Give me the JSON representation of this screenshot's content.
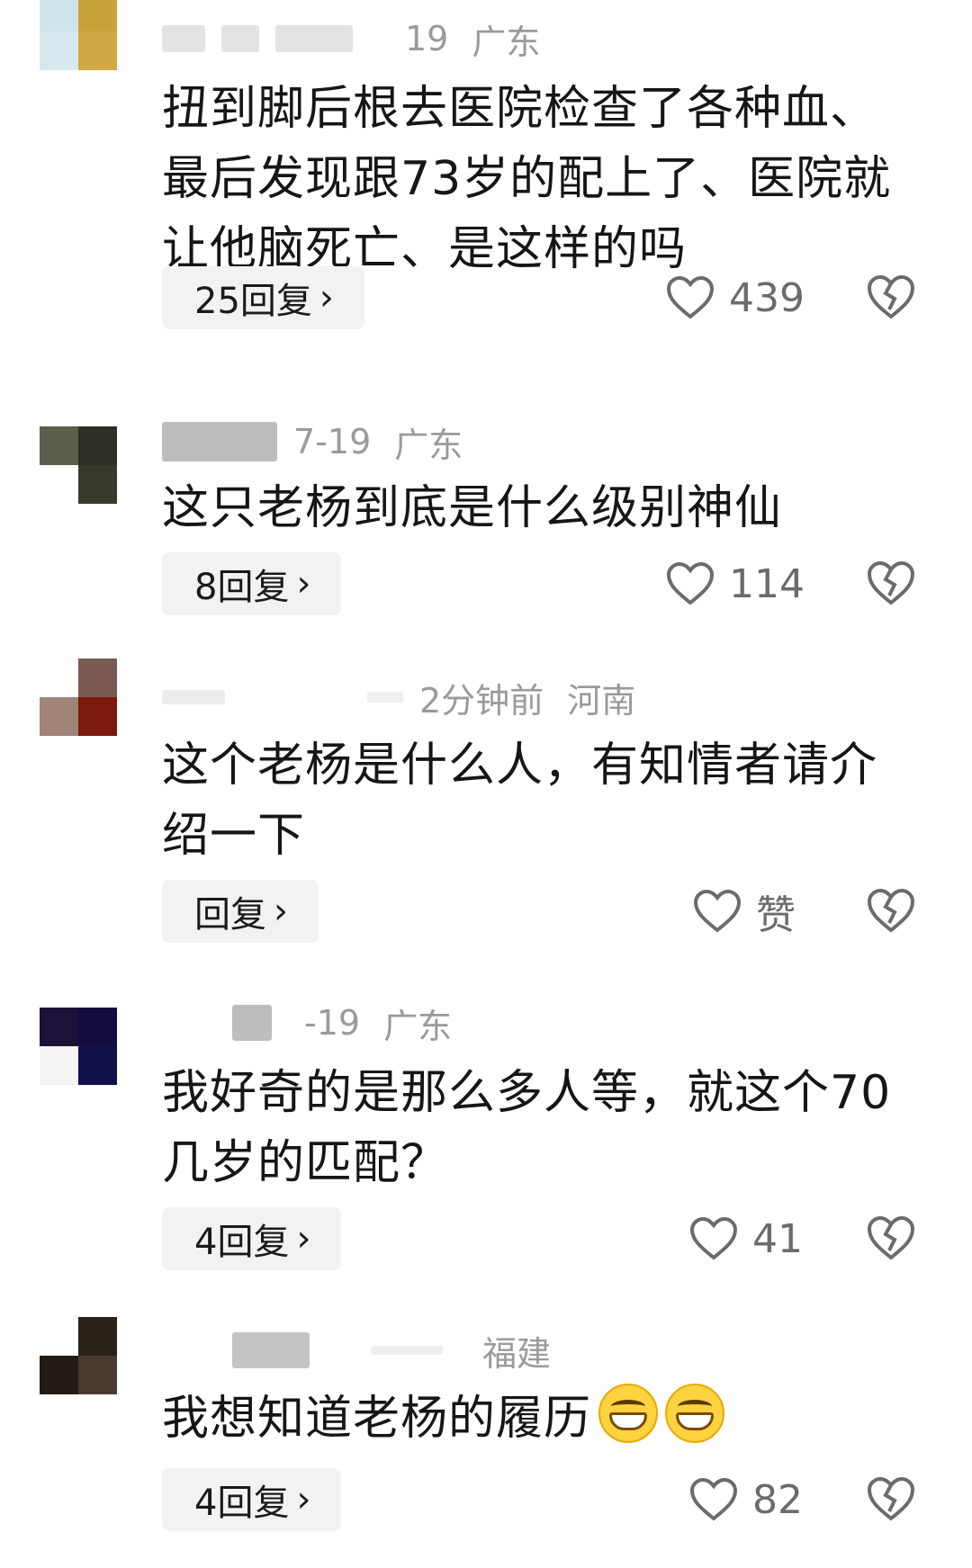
{
  "comments": [
    {
      "time": "19",
      "location": "广东",
      "text": "扭到脚后根去医院检查了各种血、最后发现跟73岁的配上了、医院就让他脑死亡、是这样的吗",
      "reply_label": "25回复",
      "likes": "439"
    },
    {
      "time": "7-19",
      "location": "广东",
      "text": "这只老杨到底是什么级别神仙",
      "reply_label": "8回复",
      "likes": "114"
    },
    {
      "time": "2分钟前",
      "location": "河南",
      "text": "这个老杨是什么人，有知情者请介绍一下",
      "reply_label": "回复",
      "likes": "赞"
    },
    {
      "time": "-19",
      "location": "广东",
      "text": "我好奇的是那么多人等，就这个70几岁的匹配？",
      "reply_label": "4回复",
      "likes": "41"
    },
    {
      "time": "",
      "location": "福建",
      "text": "我想知道老杨的履历",
      "reply_label": "4回复",
      "likes": "82"
    }
  ],
  "icons": {
    "like": "heart-outline-icon",
    "dislike": "broken-heart-icon",
    "emoji": "grinning-face-emoji",
    "reply_chevron": "chevron-right-icon"
  },
  "colors": {
    "meta_text": "#9a9a9a",
    "reply_button_bg": "#f2f2f2",
    "icon_gray": "#6b6b6b"
  }
}
